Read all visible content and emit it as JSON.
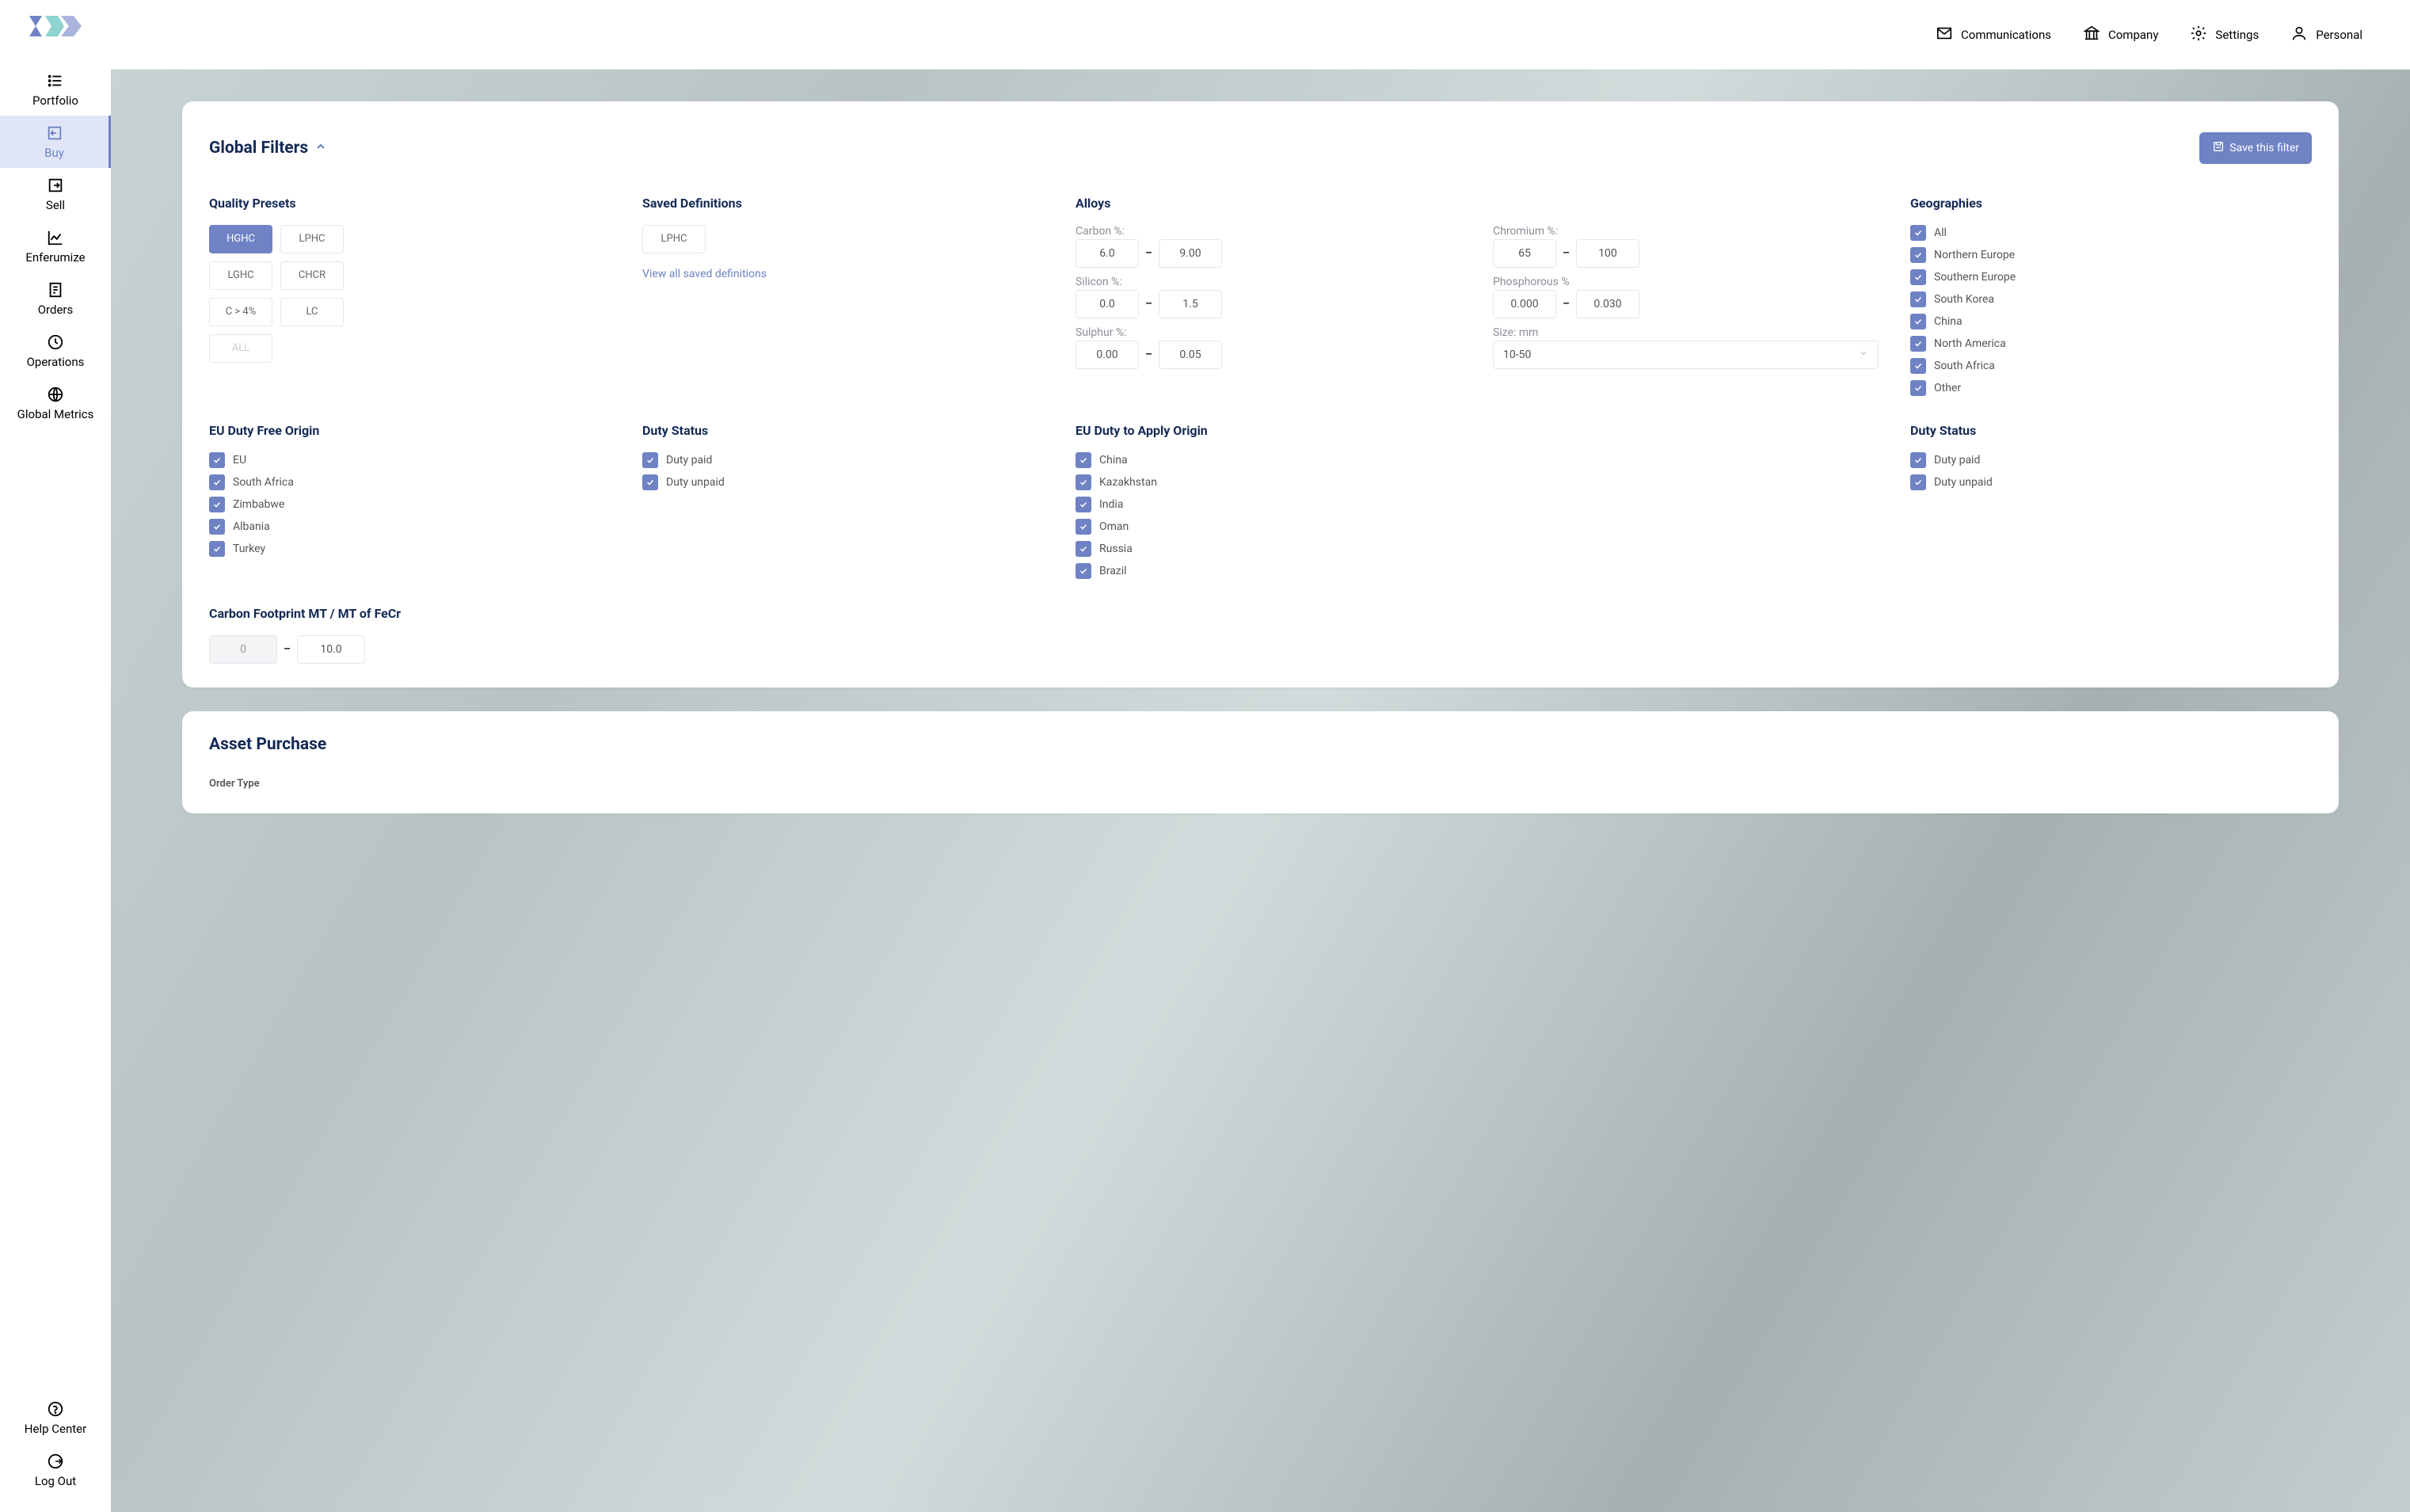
{
  "topnav": {
    "communications": "Communications",
    "company": "Company",
    "settings": "Settings",
    "personal": "Personal"
  },
  "sidenav": {
    "portfolio": "Portfolio",
    "buy": "Buy",
    "sell": "Sell",
    "enferumize": "Enferumize",
    "orders": "Orders",
    "operations": "Operations",
    "global_metrics": "Global Metrics",
    "help_center": "Help Center",
    "log_out": "Log Out"
  },
  "filters": {
    "title": "Global Filters",
    "save_label": "Save this filter",
    "quality_presets": {
      "title": "Quality Presets",
      "items": [
        "HGHC",
        "LPHC",
        "LGHC",
        "CHCR",
        "C > 4%",
        "LC",
        "ALL"
      ]
    },
    "saved_definitions": {
      "title": "Saved Definitions",
      "items": [
        "LPHC"
      ],
      "view_all": "View all saved definitions"
    },
    "alloys": {
      "title": "Alloys",
      "carbon": {
        "label": "Carbon %:",
        "min": "6.0",
        "max": "9.00"
      },
      "silicon": {
        "label": "Silicon %:",
        "min": "0.0",
        "max": "1.5"
      },
      "sulphur": {
        "label": "Sulphur %:",
        "min": "0.00",
        "max": "0.05"
      },
      "chromium": {
        "label": "Chromium %:",
        "min": "65",
        "max": "100"
      },
      "phosphorous": {
        "label": "Phosphorous %",
        "min": "0.000",
        "max": "0.030"
      },
      "size": {
        "label": "Size: mm",
        "value": "10-50"
      }
    },
    "geographies": {
      "title": "Geographies",
      "items": [
        "All",
        "Northern Europe",
        "Southern Europe",
        "South Korea",
        "China",
        "North America",
        "South Africa",
        "Other"
      ]
    },
    "eu_duty_free": {
      "title": "EU Duty Free Origin",
      "items": [
        "EU",
        "South Africa",
        "Zimbabwe",
        "Albania",
        "Turkey"
      ]
    },
    "duty_status_1": {
      "title": "Duty Status",
      "items": [
        "Duty paid",
        "Duty unpaid"
      ]
    },
    "eu_duty_apply": {
      "title": "EU Duty to Apply Origin",
      "items": [
        "China",
        "Kazakhstan",
        "India",
        "Oman",
        "Russia",
        "Brazil"
      ]
    },
    "duty_status_2": {
      "title": "Duty Status",
      "items": [
        "Duty paid",
        "Duty unpaid"
      ]
    },
    "footprint": {
      "title": "Carbon Footprint MT / MT of FeCr",
      "min": "0",
      "max": "10.0"
    }
  },
  "asset": {
    "title": "Asset Purchase",
    "order_type_label": "Order Type"
  }
}
